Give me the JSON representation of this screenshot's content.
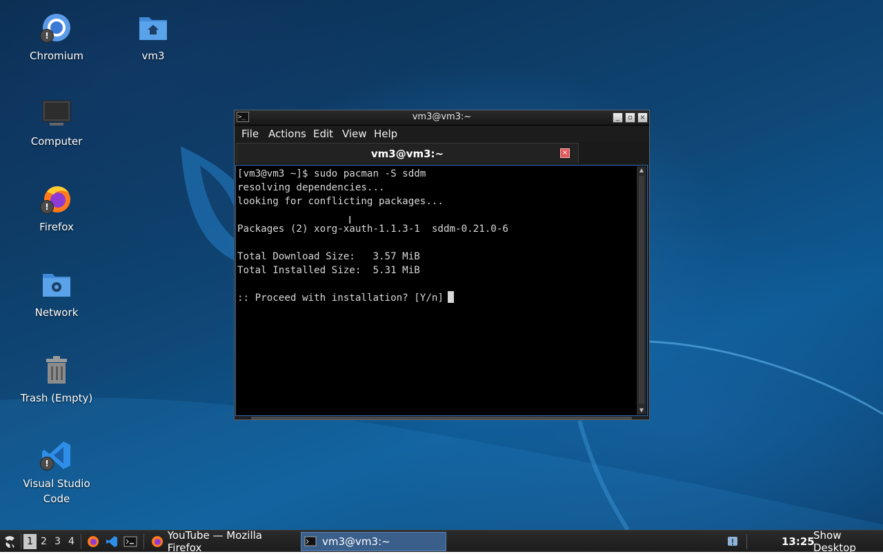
{
  "desktop": {
    "icons": [
      {
        "label": "Chromium",
        "icon": "chromium-icon",
        "badge": "!"
      },
      {
        "label": "vm3",
        "icon": "home-folder-icon"
      },
      {
        "label": "Computer",
        "icon": "computer-icon"
      },
      {
        "label": "Firefox",
        "icon": "firefox-icon",
        "badge": "!"
      },
      {
        "label": "Network",
        "icon": "network-folder-icon"
      },
      {
        "label": "Trash (Empty)",
        "icon": "trash-icon"
      },
      {
        "label": "Visual Studio Code",
        "icon": "vscode-icon",
        "badge": "!"
      }
    ]
  },
  "terminal_window": {
    "title": "vm3@vm3:~",
    "app_icon_glyph": ">_",
    "controls": {
      "minimize": "_",
      "maximize": "▫",
      "close": "×"
    },
    "menu": [
      "File",
      "Actions",
      "Edit",
      "View",
      "Help"
    ],
    "tab": {
      "label": "vm3@vm3:~",
      "close_glyph": "×"
    },
    "lines": [
      "[vm3@vm3 ~]$ sudo pacman -S sddm",
      "resolving dependencies...",
      "looking for conflicting packages...",
      "",
      "Packages (2) xorg-xauth-1.1.3-1  sddm-0.21.0-6",
      "",
      "Total Download Size:   3.57 MiB",
      "Total Installed Size:  5.31 MiB",
      "",
      ":: Proceed with installation? [Y/n]"
    ],
    "text_cursor_glyph": "I"
  },
  "taskbar": {
    "menu_icon": "lxqt-menu-icon",
    "workspaces": [
      "1",
      "2",
      "3",
      "4"
    ],
    "active_workspace": "1",
    "quicklaunch": [
      "firefox-icon",
      "vscode-icon",
      "terminal-icon"
    ],
    "tasks": [
      {
        "label": "YouTube — Mozilla Firefox",
        "icon": "firefox-icon",
        "active": false
      },
      {
        "label": "vm3@vm3:~",
        "icon": "terminal-icon",
        "active": true
      }
    ],
    "tray_icon": "notification-icon",
    "clock": "13:25",
    "show_desktop": "Show Desktop"
  },
  "colors": {
    "terminal_bg": "#000000",
    "terminal_fg": "#d8d8d8",
    "active_task": "#3a5f8a",
    "tab_close": "#e25a5a"
  }
}
